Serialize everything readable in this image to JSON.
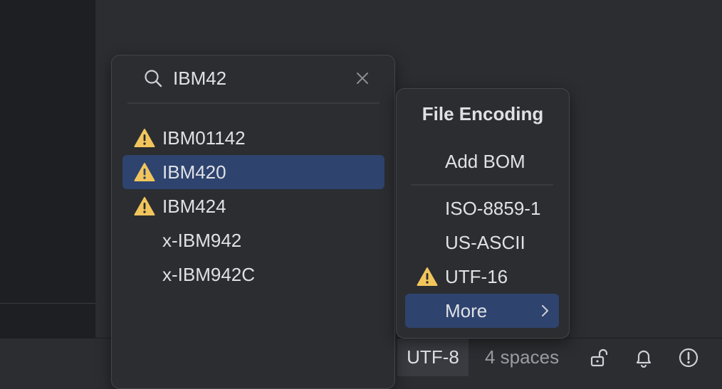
{
  "search_popup": {
    "query": "IBM42",
    "results": [
      {
        "label": "IBM01142",
        "warning": true,
        "selected": false
      },
      {
        "label": "IBM420",
        "warning": true,
        "selected": true
      },
      {
        "label": "IBM424",
        "warning": true,
        "selected": false
      },
      {
        "label": "x-IBM942",
        "warning": false,
        "selected": false
      },
      {
        "label": "x-IBM942C",
        "warning": false,
        "selected": false
      }
    ]
  },
  "encoding_menu": {
    "title": "File Encoding",
    "add_bom": "Add BOM",
    "items": [
      {
        "label": "ISO-8859-1",
        "warning": false
      },
      {
        "label": "US-ASCII",
        "warning": false
      },
      {
        "label": "UTF-16",
        "warning": true
      }
    ],
    "more": "More"
  },
  "status_bar": {
    "encoding": "UTF-8",
    "indent": "4 spaces"
  },
  "colors": {
    "selection": "#2e436e",
    "warning": "#f2c55c",
    "background": "#2b2d30"
  }
}
